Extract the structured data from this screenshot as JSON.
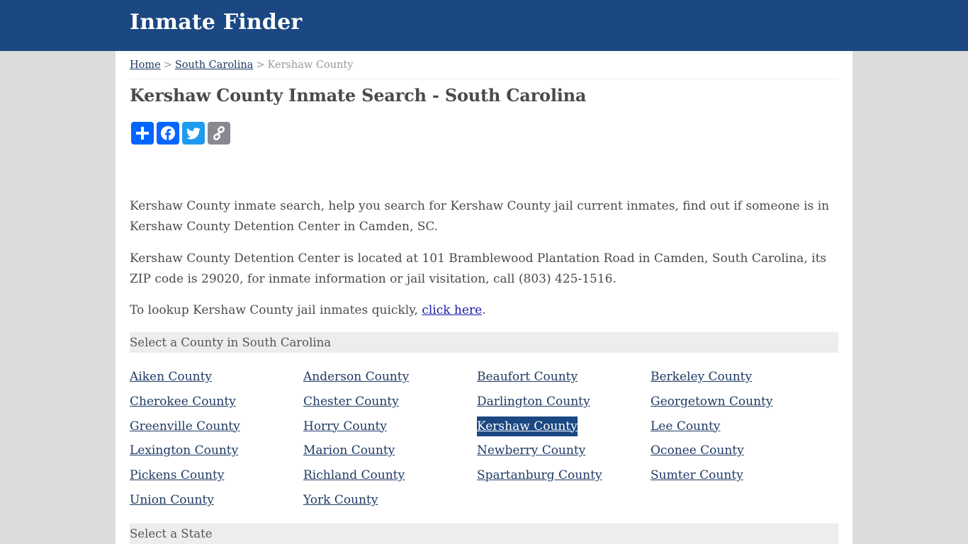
{
  "header": {
    "site_title": "Inmate Finder",
    "brand_color": "#1b4882"
  },
  "breadcrumb": {
    "items": [
      {
        "label": "Home",
        "link": true
      },
      {
        "label": "South Carolina",
        "link": true
      },
      {
        "label": "Kershaw County",
        "link": false
      }
    ],
    "separator": ">"
  },
  "page_title": "Kershaw County Inmate Search - South Carolina",
  "share_buttons": [
    {
      "name": "share",
      "icon": "plus-icon",
      "color": "#0166ff"
    },
    {
      "name": "facebook",
      "icon": "facebook-icon",
      "color": "#0866ff"
    },
    {
      "name": "twitter",
      "icon": "twitter-icon",
      "color": "#1d9bf0"
    },
    {
      "name": "copy-link",
      "icon": "link-icon",
      "color": "#888990"
    }
  ],
  "paragraphs": {
    "intro": "Kershaw County inmate search, help you search for Kershaw County jail current inmates, find out if someone is in Kershaw County Detention Center in Camden, SC.",
    "location": "Kershaw County Detention Center is located at 101 Bramblewood Plantation Road in Camden, South Carolina, its ZIP code is 29020, for inmate information or jail visitation, call (803) 425-1516.",
    "lookup_prefix": "To lookup Kershaw County jail inmates quickly, ",
    "lookup_link": "click here",
    "lookup_suffix": "."
  },
  "county_section": {
    "heading": "Select a County in South Carolina",
    "counties": [
      "Aiken County",
      "Anderson County",
      "Beaufort County",
      "Berkeley County",
      "Cherokee County",
      "Chester County",
      "Darlington County",
      "Georgetown County",
      "Greenville County",
      "Horry County",
      "Kershaw County",
      "Lee County",
      "Lexington County",
      "Marion County",
      "Newberry County",
      "Oconee County",
      "Pickens County",
      "Richland County",
      "Spartanburg County",
      "Sumter County",
      "Union County",
      "York County"
    ],
    "selected": "Kershaw County"
  },
  "state_section": {
    "heading": "Select a State"
  }
}
